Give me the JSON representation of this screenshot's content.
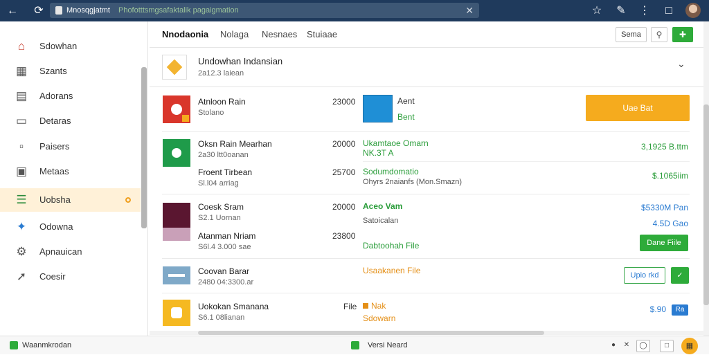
{
  "browser": {
    "url_domain": "Mnosqgjatmt",
    "url_path": "Phofotttsmgsafaktalik pagaigmation"
  },
  "sidebar": {
    "items": [
      {
        "label": "Sdowhan",
        "icon": "house-icon"
      },
      {
        "label": "Szants",
        "icon": "building-icon"
      },
      {
        "label": "Adorans",
        "icon": "document-icon"
      },
      {
        "label": "Detaras",
        "icon": "window-icon"
      },
      {
        "label": "Paisers",
        "icon": "clipboard-icon"
      },
      {
        "label": "Metaas",
        "icon": "monitor-icon"
      },
      {
        "label": "Uobsha",
        "icon": "stack-icon"
      },
      {
        "label": "Odowna",
        "icon": "star-icon"
      },
      {
        "label": "Apnauican",
        "icon": "gear-icon"
      },
      {
        "label": "Coesir",
        "icon": "wrench-icon"
      }
    ]
  },
  "header": {
    "tabs": [
      "Nnodaonia",
      "Nolaga",
      "Nesnaes",
      "Stuiaae"
    ],
    "save_label": "Sema"
  },
  "section": {
    "title": "Undowhan Indansian",
    "subtitle": "2a12.3 laiean"
  },
  "rows": [
    {
      "title": "Atnloon Rain",
      "subtitle": "Stolano",
      "number": "23000",
      "mid1": "Aent",
      "mid2": "Bent",
      "button": "Uae Bat"
    },
    {
      "title": "Oksn Rain Mearhan",
      "subtitle": "2a30 ltt0oanan",
      "number": "20000",
      "mid1": "Ukamtaoe Omarn",
      "mid2": "NK.3T A",
      "right": "3,1925 B.ttm"
    },
    {
      "title": "Froent Tirbean",
      "subtitle": "Sl.l04 arriag",
      "number": "25700",
      "mid1": "Sodumdomatio",
      "mid2": "Ohyrs 2naianfs (Mon.Smazn)",
      "right": "$.1065iim"
    },
    {
      "title": "Coesk Sram",
      "subtitle": "S2.1 Uornan",
      "number": "20000",
      "mid1": "Aceo Vam",
      "mid2": "Satoicalan",
      "right": "$5330M Pan"
    },
    {
      "title": "Atanman Nriam",
      "subtitle": "S6l.4 3.000 sae",
      "number": "23800",
      "mid1": "Dabtoohah File",
      "right": "4.5D Gao",
      "button": "Dane Fiile"
    },
    {
      "title": "Coovan Barar",
      "subtitle": "2480 04:3300.ar",
      "mid1": "Usaakanen File",
      "button": "Upio rkd"
    },
    {
      "title": "Uokokan Smanana",
      "subtitle": "S6.1 08lianan",
      "number": "File",
      "mid1": "Nak",
      "mid2": "Sdowarn",
      "right": "$.90",
      "badge": "Ra"
    }
  ],
  "status": {
    "left": "Waanmkrodan",
    "center": "Versi Neard"
  }
}
